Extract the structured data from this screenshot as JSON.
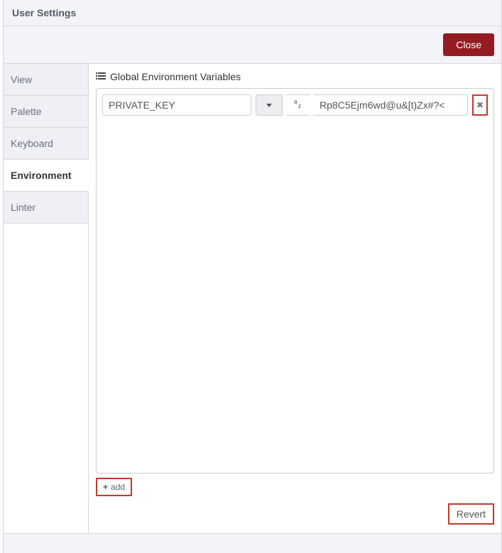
{
  "header": {
    "title": "User Settings"
  },
  "close": {
    "label": "Close"
  },
  "sidebar": {
    "items": [
      {
        "label": "View",
        "active": false
      },
      {
        "label": "Palette",
        "active": false
      },
      {
        "label": "Keyboard",
        "active": false
      },
      {
        "label": "Environment",
        "active": true
      },
      {
        "label": "Linter",
        "active": false
      }
    ]
  },
  "main": {
    "section_title": "Global Environment Variables",
    "variables": [
      {
        "key": "PRIVATE_KEY",
        "value": "Rp8C5Ejm6wd@u&[t)Zx#?<"
      }
    ],
    "add_label": "add",
    "revert_label": "Revert"
  }
}
